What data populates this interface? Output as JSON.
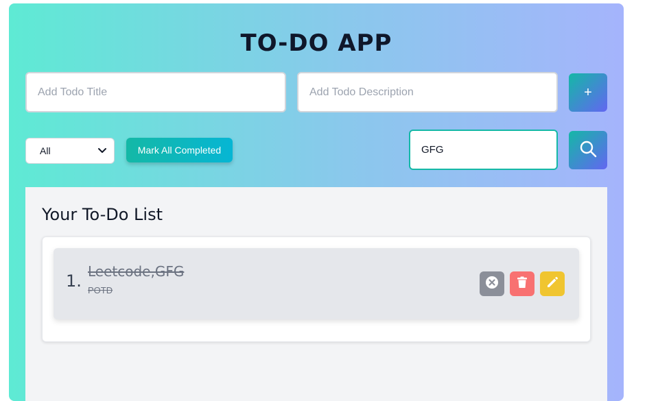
{
  "app": {
    "title": "TO-DO APP"
  },
  "add_form": {
    "title_placeholder": "Add Todo Title",
    "description_placeholder": "Add Todo Description",
    "add_button_label": "+"
  },
  "toolbar": {
    "filter_selected": "All",
    "mark_all_label": "Mark All Completed",
    "search_value": "GFG",
    "search_icon": "search-icon"
  },
  "list": {
    "heading": "Your To-Do List",
    "items": [
      {
        "number": "1.",
        "title": "Leetcode,GFG",
        "description": "POTD",
        "completed": true,
        "actions": [
          "x-circle-icon",
          "trash-icon",
          "pencil-icon"
        ]
      }
    ]
  },
  "colors": {
    "gradient_start": "#5eead4",
    "gradient_end": "#a5b4fc",
    "accent_teal": "#14b8a6",
    "delete_red": "#f87171",
    "edit_yellow": "#f0c530",
    "uncomplete_gray": "#8b8f99"
  }
}
